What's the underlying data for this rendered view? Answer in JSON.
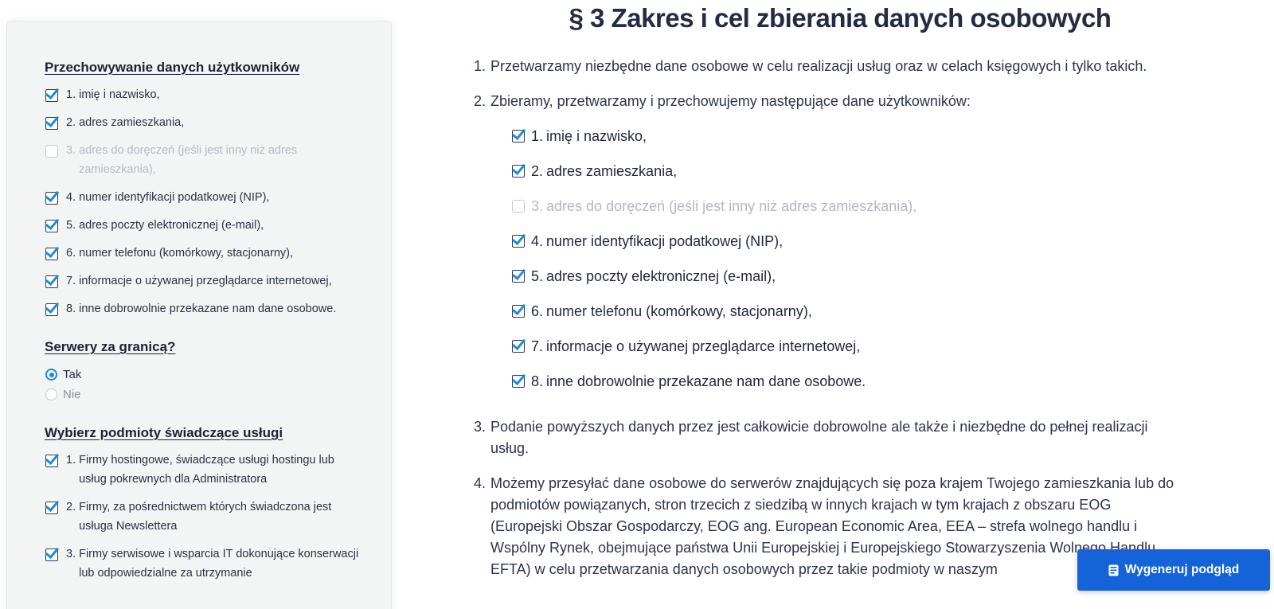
{
  "sidebar": {
    "section1": {
      "heading": "Przechowywanie danych użytkowników",
      "items": [
        {
          "num": "1.",
          "text": "imię i nazwisko,",
          "checked": true
        },
        {
          "num": "2.",
          "text": "adres zamieszkania,",
          "checked": true
        },
        {
          "num": "3.",
          "text": "adres do doręczeń (jeśli jest inny niż adres zamieszkania),",
          "checked": false
        },
        {
          "num": "4.",
          "text": "numer identyfikacji podatkowej (NIP),",
          "checked": true
        },
        {
          "num": "5.",
          "text": "adres poczty elektronicznej (e-mail),",
          "checked": true
        },
        {
          "num": "6.",
          "text": "numer telefonu (komórkowy, stacjonarny),",
          "checked": true
        },
        {
          "num": "7.",
          "text": "informacje o używanej przeglądarce internetowej,",
          "checked": true
        },
        {
          "num": "8.",
          "text": "inne dobrowolnie przekazane nam dane osobowe.",
          "checked": true
        }
      ]
    },
    "section2": {
      "heading": "Serwery za granicą?",
      "options": [
        {
          "label": "Tak",
          "selected": true
        },
        {
          "label": "Nie",
          "selected": false
        }
      ]
    },
    "section3": {
      "heading": "Wybierz podmioty świadczące usługi",
      "items": [
        {
          "num": "1.",
          "text": "Firmy hostingowe, świadczące usługi hostingu lub usług pokrewnych dla Administratora",
          "checked": true
        },
        {
          "num": "2.",
          "text": "Firmy, za pośrednictwem których świadczona jest usługa Newslettera",
          "checked": true
        },
        {
          "num": "3.",
          "text": "Firmy serwisowe i wsparcia IT dokonujące konserwacji lub odpowiedzialne za utrzymanie",
          "checked": true
        }
      ]
    }
  },
  "main": {
    "title": "§ 3 Zakres i cel zbierania danych osobowych",
    "items": [
      {
        "num": "1.",
        "text": "Przetwarzamy niezbędne dane osobowe w celu realizacji usług oraz w celach księgowych i tylko takich."
      },
      {
        "num": "2.",
        "text": "Zbieramy, przetwarzamy i przechowujemy następujące dane użytkowników:"
      },
      {
        "num": "3.",
        "text": "Podanie powyższych danych przez jest całkowicie dobrowolne ale także i niezbędne do pełnej realizacji usług."
      },
      {
        "num": "4.",
        "text": "Możemy przesyłać dane osobowe do serwerów znajdujących się poza krajem Twojego zamieszkania lub do podmiotów powiązanych, stron trzecich z siedzibą w innych krajach w tym krajach z obszaru EOG (Europejski Obszar Gospodarczy, EOG ang. European Economic Area, EEA – strefa wolnego handlu i Wspólny Rynek, obejmujące państwa Unii Europejskiej i Europejskiego Stowarzyszenia Wolnego Handlu EFTA) w celu przetwarzania danych osobowych przez takie podmioty w naszym"
      }
    ],
    "sub_items": [
      {
        "num": "1.",
        "text": "imię i nazwisko,",
        "checked": true
      },
      {
        "num": "2.",
        "text": "adres zamieszkania,",
        "checked": true
      },
      {
        "num": "3.",
        "text": "adres do doręczeń (jeśli jest inny niż adres zamieszkania),",
        "checked": false
      },
      {
        "num": "4.",
        "text": "numer identyfikacji podatkowej (NIP),",
        "checked": true
      },
      {
        "num": "5.",
        "text": "adres poczty elektronicznej (e-mail),",
        "checked": true
      },
      {
        "num": "6.",
        "text": "numer telefonu (komórkowy, stacjonarny),",
        "checked": true
      },
      {
        "num": "7.",
        "text": "informacje o używanej przeglądarce internetowej,",
        "checked": true
      },
      {
        "num": "8.",
        "text": "inne dobrowolnie przekazane nam dane osobowe.",
        "checked": true
      }
    ]
  },
  "button": {
    "label": "Wygeneruj podgląd",
    "icon": "document-icon"
  },
  "colors": {
    "accent": "#1463d8",
    "check": "#1d8bdb",
    "sidebar_bg": "#f3f4f4",
    "text": "#2b3350"
  }
}
